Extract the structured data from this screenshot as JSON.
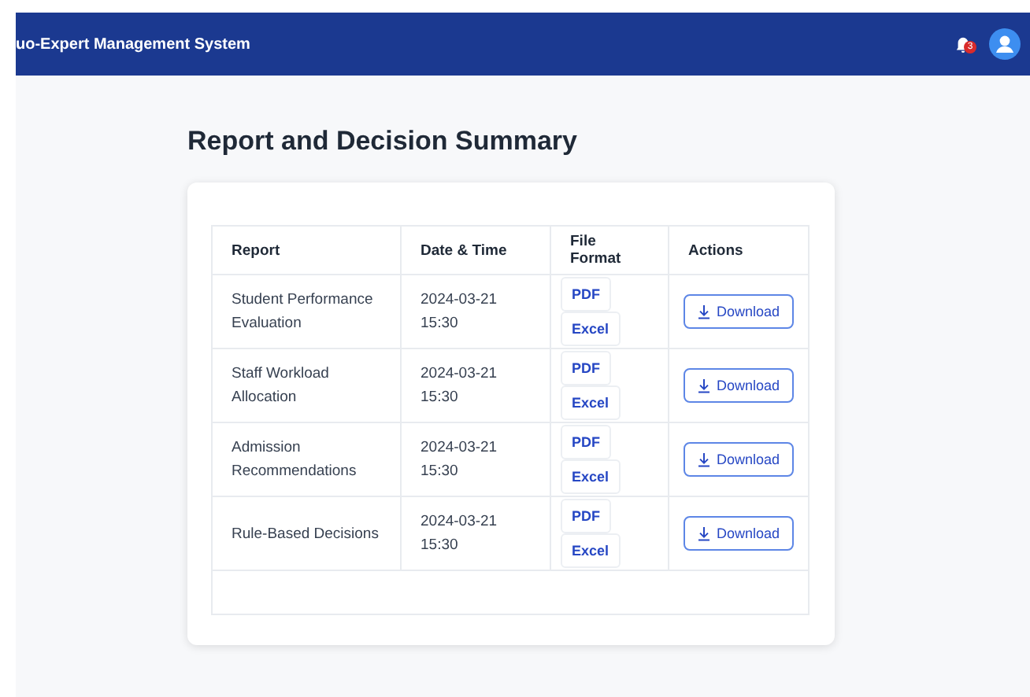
{
  "header": {
    "title": "uo-Expert Management System",
    "notification_count": "3"
  },
  "page": {
    "title": "Report and Decision Summary"
  },
  "table": {
    "columns": [
      "Report",
      "Date & Time",
      "File Format",
      "Actions"
    ],
    "rows": [
      {
        "report": "Student Performance Evaluation",
        "date": "2024-03-21",
        "time": "15:30",
        "formats": [
          "PDF",
          "Excel"
        ],
        "action": "Download"
      },
      {
        "report": "Staff Workload Allocation",
        "date": "2024-03-21",
        "time": "15:30",
        "formats": [
          "PDF",
          "Excel"
        ],
        "action": "Download"
      },
      {
        "report": "Admission Recommendations",
        "date": "2024-03-21",
        "time": "15:30",
        "formats": [
          "PDF",
          "Excel"
        ],
        "action": "Download"
      },
      {
        "report": "Rule-Based Decisions",
        "date": "2024-03-21",
        "time": "15:30",
        "formats": [
          "PDF",
          "Excel"
        ],
        "action": "Download"
      }
    ]
  }
}
